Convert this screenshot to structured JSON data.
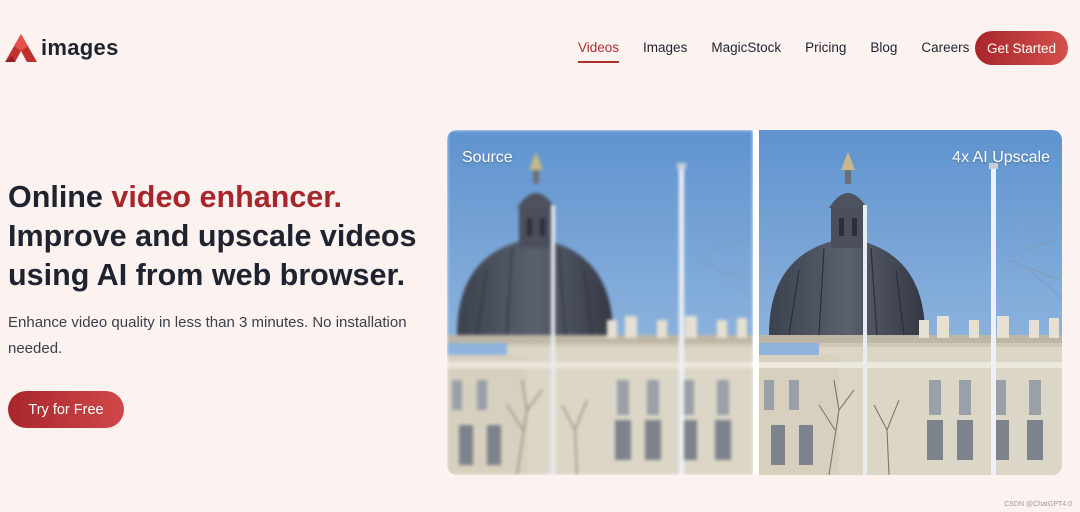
{
  "brand": {
    "name": "images",
    "logo_icon": "red-triangle-logo",
    "accent_color": "#a8262b"
  },
  "nav": {
    "items": [
      {
        "label": "Videos",
        "active": true
      },
      {
        "label": "Images",
        "active": false
      },
      {
        "label": "MagicStock",
        "active": false
      },
      {
        "label": "Pricing",
        "active": false
      },
      {
        "label": "Blog",
        "active": false
      },
      {
        "label": "Careers",
        "active": false
      }
    ],
    "cta_label": "Get Started"
  },
  "hero": {
    "title_prefix": "Online ",
    "title_accent": "video enhancer.",
    "title_rest": "Improve and upscale videos using AI from web browser.",
    "subtitle": "Enhance video quality in less than 3 minutes. No installation needed.",
    "button_label": "Try for Free"
  },
  "comparison": {
    "left_label": "Source",
    "right_label": "4x AI Upscale"
  },
  "watermark": "CSDN @ChatGPT4.0"
}
